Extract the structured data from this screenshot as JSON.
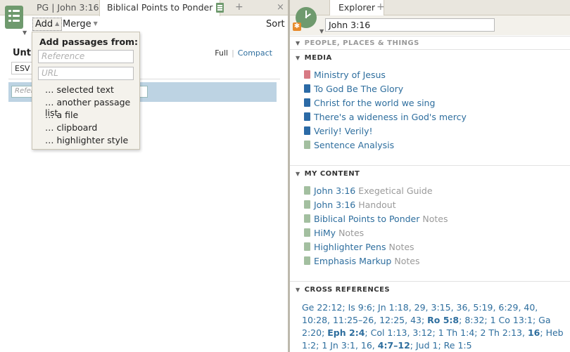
{
  "left": {
    "tabs": [
      {
        "label": "PG | John 3:16"
      },
      {
        "label": "Biblical Points to Ponder"
      }
    ],
    "tab_add": "+",
    "tab_close": "×",
    "toolbar": {
      "add": "Add",
      "merge": "Merge",
      "sort": "Sort"
    },
    "title": "Untit",
    "view": {
      "full": "Full",
      "sep": "|",
      "compact": "Compact"
    },
    "version": "ESV",
    "ref_placeholder": "Refere",
    "dropdown": {
      "title": "Add passages from:",
      "reference_placeholder": "Reference",
      "url_placeholder": "URL",
      "items": [
        "… selected text",
        "… another passage list",
        "… a file",
        "… clipboard",
        "… highlighter style"
      ]
    }
  },
  "right": {
    "tab": "Explorer",
    "tab_add": "+",
    "reference": "John 3:16",
    "sections": {
      "people": "PEOPLE, PLACES & THINGS",
      "media": "MEDIA",
      "my_content": "MY CONTENT",
      "cross_refs": "CROSS REFERENCES"
    },
    "media": [
      {
        "label": "Ministry of Jesus",
        "icon": "slides-icon"
      },
      {
        "label": "To God Be The Glory",
        "icon": "book-icon"
      },
      {
        "label": "Christ for the world we sing",
        "icon": "book-icon"
      },
      {
        "label": "There's a wideness in God's mercy",
        "icon": "book-icon"
      },
      {
        "label": "Verily! Verily!",
        "icon": "book-icon"
      },
      {
        "label": "Sentence Analysis",
        "icon": "document-icon"
      }
    ],
    "my_content": [
      {
        "label": "John 3:16",
        "note": "Exegetical Guide"
      },
      {
        "label": "John 3:16",
        "note": "Handout"
      },
      {
        "label": "Biblical Points to Ponder",
        "note": "Notes"
      },
      {
        "label": "HiMy",
        "note": "Notes"
      },
      {
        "label": "Highlighter Pens",
        "note": "Notes"
      },
      {
        "label": "Emphasis Markup",
        "note": "Notes"
      }
    ],
    "cross_references": [
      {
        "text": "Ge 22:12",
        "bold": false
      },
      {
        "text": "Is 9:6",
        "bold": false
      },
      {
        "text": "Jn 1:18, 29, 3:15, 36, 5:19, 6:29, 40, 10:28, 11:25–26, 12:25, 43",
        "bold": false
      },
      {
        "text": "Ro 5:8",
        "bold": true
      },
      {
        "text": "8:32",
        "bold": false
      },
      {
        "text": "1 Co 13:1",
        "bold": false
      },
      {
        "text": "Ga 2:20",
        "bold": false
      },
      {
        "text": "Eph 2:4",
        "bold": true
      },
      {
        "text": "Col 1:13, 3:12",
        "bold": false
      },
      {
        "text": "1 Th 1:4",
        "bold": false
      },
      {
        "text": "2 Th 2:13,",
        "bold": false
      },
      {
        "text": "16",
        "bold": true
      },
      {
        "text": "Heb 1:2",
        "bold": false
      },
      {
        "text": "1 Jn 3:1, 16,",
        "bold": false
      },
      {
        "text": "4:7–12",
        "bold": true
      },
      {
        "text": "Jud 1",
        "bold": false
      },
      {
        "text": "Re 1:5",
        "bold": false
      }
    ]
  }
}
